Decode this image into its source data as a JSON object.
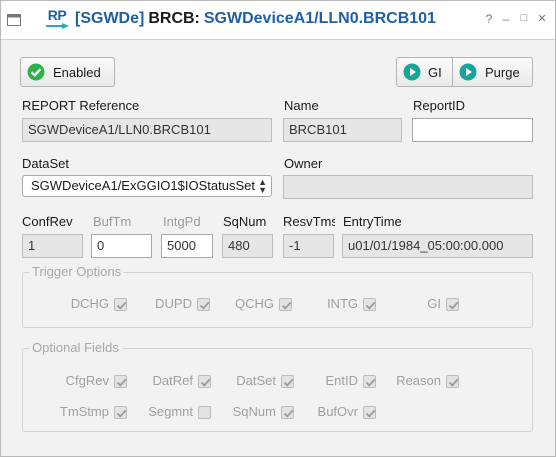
{
  "window": {
    "logo_text": "RP",
    "title_tag": "[SGWDe]",
    "title_name": "BRCB:",
    "title_path": "SGWDeviceA1/LLN0.BRCB101",
    "help": "?",
    "minimize": "–",
    "maximize": "□",
    "close": "✕"
  },
  "toolbar": {
    "enabled_label": "Enabled",
    "gi_label": "GI",
    "purge_label": "Purge"
  },
  "fields": {
    "report_reference_label": "REPORT Reference",
    "report_reference_value": "SGWDeviceA1/LLN0.BRCB101",
    "name_label": "Name",
    "name_value": "BRCB101",
    "report_id_label": "ReportID",
    "report_id_value": "",
    "dataset_label": "DataSet",
    "dataset_value": "SGWDeviceA1/ExGGIO1$IOStatusSet",
    "owner_label": "Owner",
    "owner_value": "",
    "confrev_label": "ConfRev",
    "confrev_value": "1",
    "buftm_label": "BufTm",
    "buftm_value": "0",
    "intgpd_label": "IntgPd",
    "intgpd_value": "5000",
    "sqnum_label": "SqNum",
    "sqnum_value": "480",
    "resvtms_label": "ResvTms",
    "resvtms_value": "-1",
    "entrytime_label": "EntryTime",
    "entrytime_value": "u01/01/1984_05:00:00.000"
  },
  "trigger_options": {
    "label": "Trigger Options",
    "items": [
      {
        "label": "DCHG",
        "checked": true
      },
      {
        "label": "DUPD",
        "checked": true
      },
      {
        "label": "QCHG",
        "checked": true
      },
      {
        "label": "INTG",
        "checked": true
      },
      {
        "label": "GI",
        "checked": true
      }
    ]
  },
  "optional_fields": {
    "label": "Optional Fields",
    "items": [
      {
        "label": "CfgRev",
        "checked": true
      },
      {
        "label": "DatRef",
        "checked": true
      },
      {
        "label": "DatSet",
        "checked": true
      },
      {
        "label": "EntID",
        "checked": true
      },
      {
        "label": "Reason",
        "checked": true
      },
      {
        "label": "TmStmp",
        "checked": true
      },
      {
        "label": "Segmnt",
        "checked": false
      },
      {
        "label": "SqNum",
        "checked": true
      },
      {
        "label": "BufOvr",
        "checked": true
      }
    ]
  },
  "colors": {
    "accent": "#1f5fa8",
    "enabled_green": "#2fb24a",
    "play_teal": "#1aa39a"
  }
}
